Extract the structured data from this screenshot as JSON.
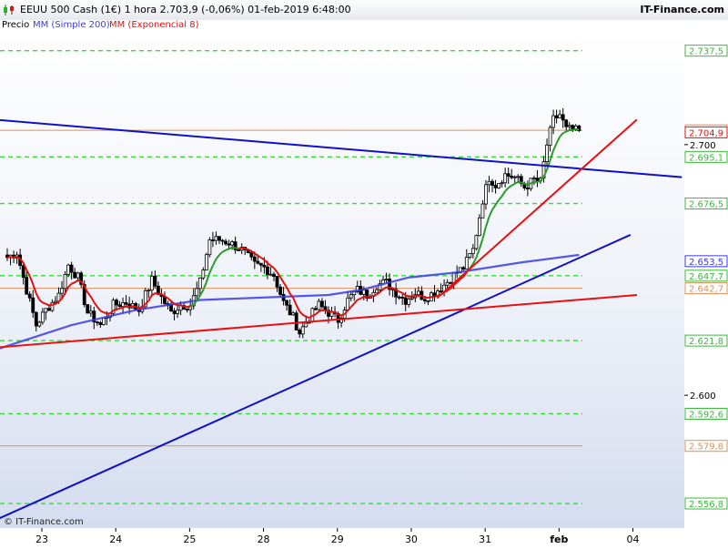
{
  "header": {
    "title": "EEUU 500 Cash (1€)    1 hora    2.703,9 (-0,06%)    01-feb-2019 6:48:00",
    "brand": "IT-Finance.com"
  },
  "legend": {
    "price_label": "Precio",
    "sma_label": "MM (Simple 200)",
    "ema_label": "MM (Exponencial 8)"
  },
  "credit": "© IT-Finance.com",
  "colors": {
    "sma": "#3a3ae8",
    "ema_up": "#2a9a2a",
    "ema_down": "#e01010",
    "trend_blue": "#1010c8",
    "trend_red": "#e81010",
    "level_green": "#33dd33",
    "level_orange": "#d9905a"
  },
  "chart_data": {
    "type": "candlestick",
    "symbol": "EEUU 500 Cash (1€)",
    "timeframe": "1 hora",
    "last_price": "2.703,9",
    "change": "-0,06%",
    "timestamp": "01-feb-2019 6:48:00",
    "ylim": [
      2547,
      2745
    ],
    "x_ticks": [
      {
        "label": "23",
        "index": 0
      },
      {
        "label": "24",
        "index": 23
      },
      {
        "label": "25",
        "index": 46
      },
      {
        "label": "28",
        "index": 69
      },
      {
        "label": "29",
        "index": 92
      },
      {
        "label": "30",
        "index": 115
      },
      {
        "label": "31",
        "index": 138
      },
      {
        "label": "feb",
        "index": 161
      },
      {
        "label": "04",
        "index": 184
      }
    ],
    "y_ticks": [
      {
        "label": "2.700",
        "value": 2700
      },
      {
        "label": "2.600",
        "value": 2600
      }
    ],
    "green_levels": [
      {
        "value": 2737.5,
        "label": "2.737,5"
      },
      {
        "value": 2695.1,
        "label": "2.695,1"
      },
      {
        "value": 2676.5,
        "label": "2.676,5"
      },
      {
        "value": 2647.7,
        "label": "2.647,7"
      },
      {
        "value": 2621.8,
        "label": "2.621,8"
      },
      {
        "value": 2592.6,
        "label": "2.592,6"
      },
      {
        "value": 2556.8,
        "label": "2.556,8"
      }
    ],
    "orange_levels": [
      {
        "value": 2705.7,
        "label": "2.705,7"
      },
      {
        "value": 2642.7,
        "label": "2.642,7"
      },
      {
        "value": 2579.8,
        "label": "2.579,8"
      }
    ],
    "value_tags": [
      {
        "value": 2704.9,
        "label": "2.704,9",
        "color": "#e01010"
      },
      {
        "value": 2653.5,
        "label": "2.653,5",
        "color": "#3a3ae8"
      }
    ],
    "trendlines": [
      {
        "color": "blue",
        "from": [
          -4,
          2710
        ],
        "to": [
          210,
          2687
        ]
      },
      {
        "color": "blue",
        "from": [
          -4,
          2550
        ],
        "to": [
          194,
          2664
        ]
      },
      {
        "color": "red",
        "from": [
          -4,
          2619
        ],
        "to": [
          196,
          2640
        ]
      },
      {
        "color": "red",
        "from": [
          134,
          2639
        ],
        "to": [
          196,
          2710
        ]
      }
    ],
    "close_path": [
      [
        0,
        2655
      ],
      [
        3,
        2657
      ],
      [
        6,
        2642
      ],
      [
        9,
        2628
      ],
      [
        12,
        2634
      ],
      [
        16,
        2640
      ],
      [
        19,
        2652
      ],
      [
        22,
        2647
      ],
      [
        25,
        2633
      ],
      [
        29,
        2628
      ],
      [
        33,
        2636
      ],
      [
        37,
        2637
      ],
      [
        41,
        2634
      ],
      [
        45,
        2646
      ],
      [
        48,
        2639
      ],
      [
        51,
        2633
      ],
      [
        54,
        2636
      ],
      [
        57,
        2636
      ],
      [
        60,
        2645
      ],
      [
        63,
        2662
      ],
      [
        66,
        2662
      ],
      [
        69,
        2661
      ],
      [
        73,
        2658
      ],
      [
        77,
        2652
      ],
      [
        80,
        2651
      ],
      [
        83,
        2648
      ],
      [
        86,
        2637
      ],
      [
        89,
        2631
      ],
      [
        91,
        2625
      ],
      [
        94,
        2631
      ],
      [
        97,
        2636
      ],
      [
        100,
        2633
      ],
      [
        103,
        2630
      ],
      [
        106,
        2638
      ],
      [
        109,
        2642
      ],
      [
        112,
        2640
      ],
      [
        115,
        2644
      ],
      [
        118,
        2645
      ],
      [
        121,
        2641
      ],
      [
        124,
        2638
      ],
      [
        127,
        2641
      ],
      [
        130,
        2639
      ],
      [
        133,
        2641
      ],
      [
        136,
        2644
      ],
      [
        139,
        2648
      ],
      [
        142,
        2651
      ],
      [
        145,
        2658
      ],
      [
        148,
        2678
      ],
      [
        150,
        2687
      ],
      [
        152,
        2684
      ],
      [
        155,
        2688
      ],
      [
        158,
        2687
      ],
      [
        161,
        2683
      ],
      [
        164,
        2686
      ],
      [
        166,
        2685
      ],
      [
        168,
        2700
      ],
      [
        170,
        2710
      ],
      [
        172,
        2712
      ],
      [
        174,
        2706
      ],
      [
        176,
        2706
      ],
      [
        178,
        2705
      ]
    ],
    "sma_path": [
      [
        -4,
        2618
      ],
      [
        20,
        2628
      ],
      [
        40,
        2634
      ],
      [
        60,
        2638
      ],
      [
        80,
        2639
      ],
      [
        100,
        2640
      ],
      [
        110,
        2642
      ],
      [
        125,
        2647
      ],
      [
        140,
        2649
      ],
      [
        160,
        2653
      ],
      [
        178,
        2656
      ]
    ],
    "ema_up_ranges": [
      [
        58,
        72
      ],
      [
        144,
        178
      ]
    ],
    "n_bars": 190
  }
}
